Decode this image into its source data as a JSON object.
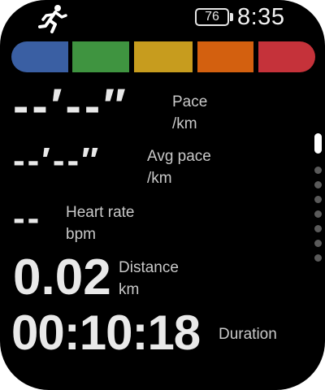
{
  "status_bar": {
    "activity_icon": "running-person-icon",
    "battery_level": "76",
    "time": "8:35"
  },
  "heart_rate_zones": [
    {
      "zone": 1,
      "color": "#3a5fa3"
    },
    {
      "zone": 2,
      "color": "#3f9440"
    },
    {
      "zone": 3,
      "color": "#c79c1e"
    },
    {
      "zone": 4,
      "color": "#d3600f"
    },
    {
      "zone": 5,
      "color": "#c5323a"
    }
  ],
  "metrics": {
    "pace": {
      "value": "--′--″",
      "label": "Pace",
      "unit": "/km"
    },
    "avg_pace": {
      "value": "--′--″",
      "label": "Avg pace",
      "unit": "/km"
    },
    "heart_rate": {
      "value": "--",
      "label": "Heart rate",
      "unit": "bpm"
    },
    "distance": {
      "value": "0.02",
      "label": "Distance",
      "unit": "km"
    },
    "duration": {
      "value": "00:10:18",
      "label": "Duration"
    }
  },
  "page_indicator": {
    "total_pages": 7,
    "current_page": 1
  }
}
